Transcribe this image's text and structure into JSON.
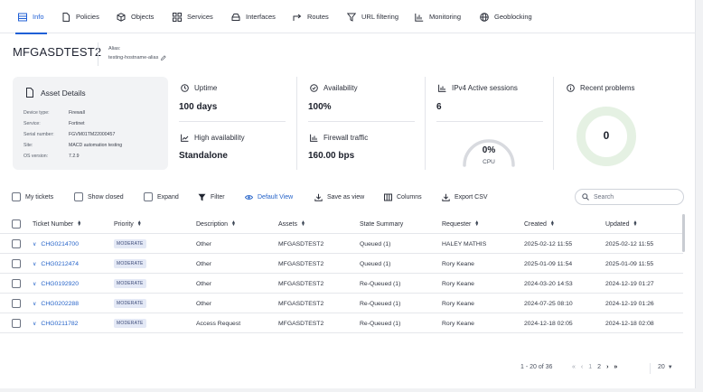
{
  "tabs": [
    {
      "label": "Info",
      "icon": "list-icon",
      "active": true
    },
    {
      "label": "Policies",
      "icon": "document-icon"
    },
    {
      "label": "Objects",
      "icon": "cube-icon"
    },
    {
      "label": "Services",
      "icon": "grid-icon"
    },
    {
      "label": "Interfaces",
      "icon": "interface-icon"
    },
    {
      "label": "Routes",
      "icon": "route-arrow-icon"
    },
    {
      "label": "URL filtering",
      "icon": "filter-icon"
    },
    {
      "label": "Monitoring",
      "icon": "bar-chart-icon"
    },
    {
      "label": "Geoblocking",
      "icon": "globe-icon"
    }
  ],
  "header": {
    "device_name": "MFGASDTEST2",
    "alias_label": "Alias:",
    "alias_value": "testing-hostname-alias"
  },
  "asset": {
    "title": "Asset Details",
    "rows": [
      {
        "k": "Device type:",
        "v": "Firewall"
      },
      {
        "k": "Service:",
        "v": "Fortinet"
      },
      {
        "k": "Serial number:",
        "v": "FGVM01TM22000457"
      },
      {
        "k": "Site:",
        "v": "MACD automation testing"
      },
      {
        "k": "OS version:",
        "v": "7.2.9"
      }
    ]
  },
  "metrics": {
    "uptime_label": "Uptime",
    "uptime_value": "100 days",
    "availability_label": "Availability",
    "availability_value": "100%",
    "ipv4_label": "IPv4 Active sessions",
    "ipv4_value": "6",
    "ha_label": "High availability",
    "ha_value": "Standalone",
    "traffic_label": "Firewall traffic",
    "traffic_value": "160.00 bps",
    "cpu_value": "0%",
    "cpu_label": "CPU",
    "cpu_fraction": 0,
    "problems_label": "Recent problems",
    "problems_value": "0"
  },
  "toolbar": {
    "my_tickets": "My tickets",
    "show_closed": "Show closed",
    "expand": "Expand",
    "filter": "Filter",
    "default_view": "Default View",
    "save_as_view": "Save as view",
    "columns": "Columns",
    "export_csv": "Export CSV",
    "search_placeholder": "Search"
  },
  "table": {
    "headers": {
      "ticket": "Ticket Number",
      "priority": "Priority",
      "description": "Description",
      "assets": "Assets",
      "state": "State Summary",
      "requester": "Requester",
      "created": "Created",
      "updated": "Updated"
    },
    "rows": [
      {
        "ticket": "CHG0214700",
        "priority": "MODERATE",
        "description": "Other",
        "assets": "MFGASDTEST2",
        "state": "Queued (1)",
        "requester": "HALEY MATHIS",
        "created": "2025-02-12 11:55",
        "updated": "2025-02-12 11:55"
      },
      {
        "ticket": "CHG0212474",
        "priority": "MODERATE",
        "description": "Other",
        "assets": "MFGASDTEST2",
        "state": "Queued (1)",
        "requester": "Rory Keane",
        "created": "2025-01-09 11:54",
        "updated": "2025-01-09 11:55"
      },
      {
        "ticket": "CHG0192920",
        "priority": "MODERATE",
        "description": "Other",
        "assets": "MFGASDTEST2",
        "state": "Re-Queued (1)",
        "requester": "Rory Keane",
        "created": "2024-03-20 14:53",
        "updated": "2024-12-19 01:27"
      },
      {
        "ticket": "CHG0202288",
        "priority": "MODERATE",
        "description": "Other",
        "assets": "MFGASDTEST2",
        "state": "Re-Queued (1)",
        "requester": "Rory Keane",
        "created": "2024-07-25 08:10",
        "updated": "2024-12-19 01:26"
      },
      {
        "ticket": "CHG0211782",
        "priority": "MODERATE",
        "description": "Access Request",
        "assets": "MFGASDTEST2",
        "state": "Re-Queued (1)",
        "requester": "Rory Keane",
        "created": "2024-12-18 02:05",
        "updated": "2024-12-18 02:08"
      }
    ]
  },
  "pagination": {
    "range": "1 - 20 of 36",
    "page1": "1",
    "page2": "2",
    "page_size": "20"
  },
  "colors": {
    "accent": "#1f5fd6",
    "donut": "#e5f1e3"
  }
}
